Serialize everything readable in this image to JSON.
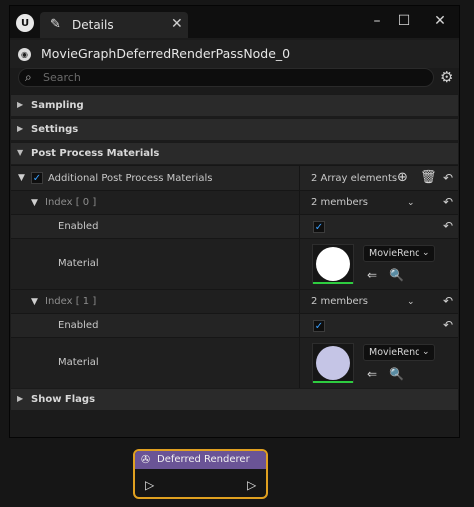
{
  "window": {
    "tab_title": "Details",
    "node_name": "MovieGraphDeferredRenderPassNode_0",
    "search_placeholder": "Search"
  },
  "categories": {
    "sampling": "Sampling",
    "settings": "Settings",
    "post_process": "Post Process Materials",
    "show_flags": "Show Flags"
  },
  "array": {
    "label": "Additional Post Process Materials",
    "summary": "2 Array elements",
    "checked": true
  },
  "elements": [
    {
      "index_label": "Index [ 0 ]",
      "members": "2 members",
      "enabled_label": "Enabled",
      "enabled": true,
      "material_label": "Material",
      "material_value": "MovieRenderPipeline",
      "thumb_color": "#ffffff"
    },
    {
      "index_label": "Index [ 1 ]",
      "members": "2 members",
      "enabled_label": "Enabled",
      "enabled": true,
      "material_label": "Material",
      "material_value": "MovieRenderPipeline",
      "thumb_color": "#c5c5e6"
    }
  ],
  "graph_node": {
    "title": "Deferred Renderer"
  },
  "icons": {
    "window": [
      "unreal-logo-icon",
      "details-icon",
      "close-tab-icon",
      "minimize-icon",
      "maximize-icon",
      "close-window-icon"
    ],
    "toolbar": [
      "search-icon",
      "settings-gear-icon"
    ],
    "rows": [
      "expand-arrow-icon",
      "reset-to-default-icon",
      "add-element-icon",
      "delete-all-icon",
      "browse-asset-icon",
      "use-selected-icon"
    ]
  },
  "colors": {
    "accent": "#3aa0ff",
    "node_header": "#6a5496",
    "node_selection": "#e0a020",
    "thumb_indicator": "#2ecc40"
  }
}
